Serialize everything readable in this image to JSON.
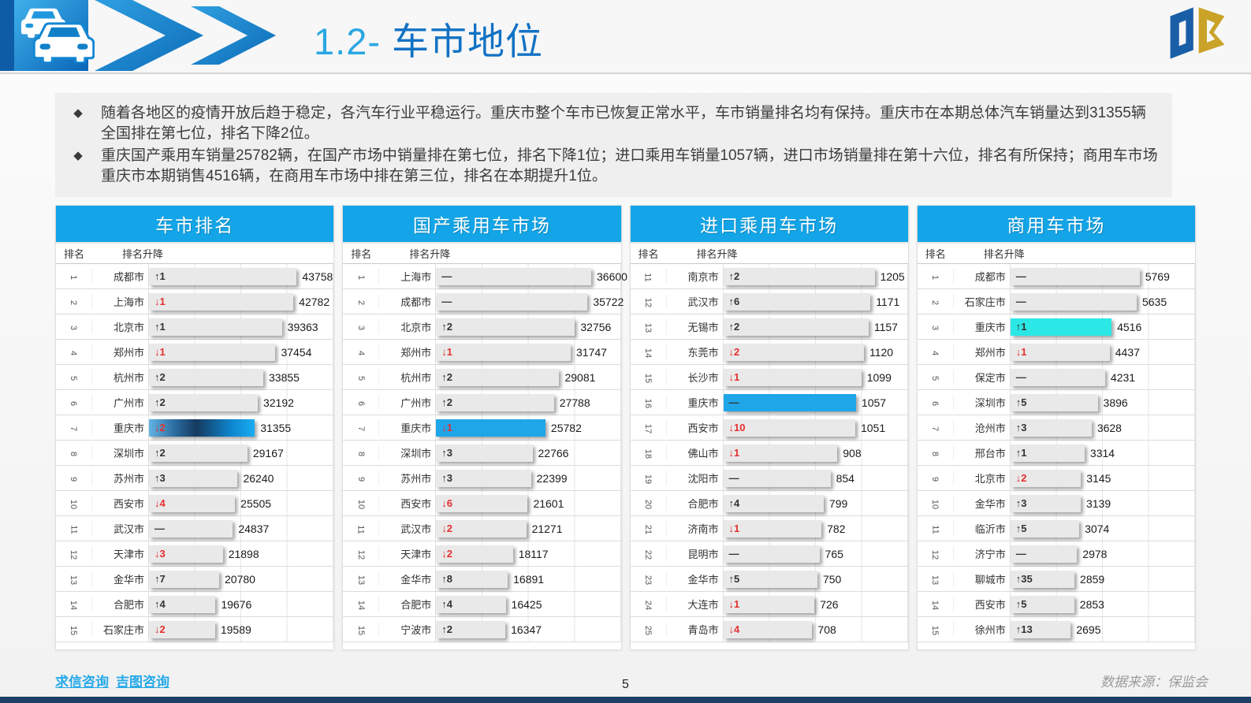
{
  "header": {
    "title_prefix": "1.2-",
    "title_main": " 车市地位"
  },
  "bullets": [
    "随着各地区的疫情开放后趋于稳定，各汽车行业平稳运行。重庆市整个车市已恢复正常水平，车市销量排名均有保持。重庆市在本期总体汽车销量达到31355辆全国排在第七位，排名下降2位。",
    "重庆国产乘用车销量25782辆，在国产市场中销量排在第七位，排名下降1位；进口乘用车销量1057辆，进口市场销量排在第十六位，排名有所保持；商用车市场重庆市本期销售4516辆，在商用车市场中排在第三位，排名在本期提升1位。"
  ],
  "columns": {
    "rank": "排名",
    "change": "排名升降"
  },
  "colors": {
    "table_header_blue": "#13a5e7",
    "highlight_blue": "#1fa6e8",
    "highlight_cyan": "#2be8e6",
    "down_red": "#e52f2f",
    "bar_gray": "#e9e9e9"
  },
  "chart_data": [
    {
      "type": "bar",
      "orientation": "horizontal",
      "title": "车市排名",
      "highlight_style": "gradient",
      "max": 43758,
      "bar_max_fraction": 0.8,
      "rows": [
        {
          "rank": "1",
          "city": "成都市",
          "change": "↑1",
          "dir": "up",
          "value": 43758,
          "highlight": false
        },
        {
          "rank": "2",
          "city": "上海市",
          "change": "↓1",
          "dir": "down",
          "value": 42782,
          "highlight": false
        },
        {
          "rank": "3",
          "city": "北京市",
          "change": "↑1",
          "dir": "up",
          "value": 39363,
          "highlight": false
        },
        {
          "rank": "4",
          "city": "郑州市",
          "change": "↓1",
          "dir": "down",
          "value": 37454,
          "highlight": false
        },
        {
          "rank": "5",
          "city": "杭州市",
          "change": "↑2",
          "dir": "up",
          "value": 33855,
          "highlight": false
        },
        {
          "rank": "6",
          "city": "广州市",
          "change": "↑2",
          "dir": "up",
          "value": 32192,
          "highlight": false
        },
        {
          "rank": "7",
          "city": "重庆市",
          "change": "↓2",
          "dir": "down",
          "value": 31355,
          "highlight": true
        },
        {
          "rank": "8",
          "city": "深圳市",
          "change": "↑2",
          "dir": "up",
          "value": 29167,
          "highlight": false
        },
        {
          "rank": "9",
          "city": "苏州市",
          "change": "↑3",
          "dir": "up",
          "value": 26240,
          "highlight": false
        },
        {
          "rank": "10",
          "city": "西安市",
          "change": "↓4",
          "dir": "down",
          "value": 25505,
          "highlight": false
        },
        {
          "rank": "11",
          "city": "武汉市",
          "change": "—",
          "dir": "flat",
          "value": 24837,
          "highlight": false
        },
        {
          "rank": "12",
          "city": "天津市",
          "change": "↓3",
          "dir": "down",
          "value": 21898,
          "highlight": false
        },
        {
          "rank": "13",
          "city": "金华市",
          "change": "↑7",
          "dir": "up",
          "value": 20780,
          "highlight": false
        },
        {
          "rank": "14",
          "city": "合肥市",
          "change": "↑4",
          "dir": "up",
          "value": 19676,
          "highlight": false
        },
        {
          "rank": "15",
          "city": "石家庄市",
          "change": "↓2",
          "dir": "down",
          "value": 19589,
          "highlight": false
        }
      ]
    },
    {
      "type": "bar",
      "orientation": "horizontal",
      "title": "国产乘用车市场",
      "highlight_style": "solid-blue",
      "max": 36600,
      "bar_max_fraction": 0.84,
      "rows": [
        {
          "rank": "1",
          "city": "上海市",
          "change": "—",
          "dir": "flat",
          "value": 36600,
          "highlight": false
        },
        {
          "rank": "2",
          "city": "成都市",
          "change": "—",
          "dir": "flat",
          "value": 35722,
          "highlight": false
        },
        {
          "rank": "3",
          "city": "北京市",
          "change": "↑2",
          "dir": "up",
          "value": 32756,
          "highlight": false
        },
        {
          "rank": "4",
          "city": "郑州市",
          "change": "↓1",
          "dir": "down",
          "value": 31747,
          "highlight": false
        },
        {
          "rank": "5",
          "city": "杭州市",
          "change": "↑2",
          "dir": "up",
          "value": 29081,
          "highlight": false
        },
        {
          "rank": "6",
          "city": "广州市",
          "change": "↑2",
          "dir": "up",
          "value": 27788,
          "highlight": false
        },
        {
          "rank": "7",
          "city": "重庆市",
          "change": "↓1",
          "dir": "down",
          "value": 25782,
          "highlight": true
        },
        {
          "rank": "8",
          "city": "深圳市",
          "change": "↑3",
          "dir": "up",
          "value": 22766,
          "highlight": false
        },
        {
          "rank": "9",
          "city": "苏州市",
          "change": "↑3",
          "dir": "up",
          "value": 22399,
          "highlight": false
        },
        {
          "rank": "10",
          "city": "西安市",
          "change": "↓6",
          "dir": "down",
          "value": 21601,
          "highlight": false
        },
        {
          "rank": "11",
          "city": "武汉市",
          "change": "↓2",
          "dir": "down",
          "value": 21271,
          "highlight": false
        },
        {
          "rank": "12",
          "city": "天津市",
          "change": "↓2",
          "dir": "down",
          "value": 18117,
          "highlight": false
        },
        {
          "rank": "13",
          "city": "金华市",
          "change": "↑8",
          "dir": "up",
          "value": 16891,
          "highlight": false
        },
        {
          "rank": "14",
          "city": "合肥市",
          "change": "↑4",
          "dir": "up",
          "value": 16425,
          "highlight": false
        },
        {
          "rank": "15",
          "city": "宁波市",
          "change": "↑2",
          "dir": "up",
          "value": 16347,
          "highlight": false
        }
      ]
    },
    {
      "type": "bar",
      "orientation": "horizontal",
      "title": "进口乘用车市场",
      "highlight_style": "solid-blue",
      "max": 1205,
      "bar_max_fraction": 0.82,
      "rows": [
        {
          "rank": "11",
          "city": "南京市",
          "change": "↑2",
          "dir": "up",
          "value": 1205,
          "highlight": false
        },
        {
          "rank": "12",
          "city": "武汉市",
          "change": "↑6",
          "dir": "up",
          "value": 1171,
          "highlight": false
        },
        {
          "rank": "13",
          "city": "无锡市",
          "change": "↑2",
          "dir": "up",
          "value": 1157,
          "highlight": false
        },
        {
          "rank": "14",
          "city": "东莞市",
          "change": "↓2",
          "dir": "down",
          "value": 1120,
          "highlight": false
        },
        {
          "rank": "15",
          "city": "长沙市",
          "change": "↓1",
          "dir": "down",
          "value": 1099,
          "highlight": false
        },
        {
          "rank": "16",
          "city": "重庆市",
          "change": "—",
          "dir": "flat",
          "value": 1057,
          "highlight": true
        },
        {
          "rank": "17",
          "city": "西安市",
          "change": "↓10",
          "dir": "down",
          "value": 1051,
          "highlight": false
        },
        {
          "rank": "18",
          "city": "佛山市",
          "change": "↓1",
          "dir": "down",
          "value": 908,
          "highlight": false
        },
        {
          "rank": "19",
          "city": "沈阳市",
          "change": "—",
          "dir": "flat",
          "value": 854,
          "highlight": false
        },
        {
          "rank": "20",
          "city": "合肥市",
          "change": "↑4",
          "dir": "up",
          "value": 799,
          "highlight": false
        },
        {
          "rank": "21",
          "city": "济南市",
          "change": "↓1",
          "dir": "down",
          "value": 782,
          "highlight": false
        },
        {
          "rank": "22",
          "city": "昆明市",
          "change": "—",
          "dir": "flat",
          "value": 765,
          "highlight": false
        },
        {
          "rank": "23",
          "city": "金华市",
          "change": "↑5",
          "dir": "up",
          "value": 750,
          "highlight": false
        },
        {
          "rank": "24",
          "city": "大连市",
          "change": "↓1",
          "dir": "down",
          "value": 726,
          "highlight": false
        },
        {
          "rank": "25",
          "city": "青岛市",
          "change": "↓4",
          "dir": "down",
          "value": 708,
          "highlight": false
        }
      ]
    },
    {
      "type": "bar",
      "orientation": "horizontal",
      "title": "商用车市场",
      "highlight_style": "cyan",
      "max": 5769,
      "bar_max_fraction": 0.7,
      "rows": [
        {
          "rank": "1",
          "city": "成都市",
          "change": "—",
          "dir": "flat",
          "value": 5769,
          "highlight": false
        },
        {
          "rank": "2",
          "city": "石家庄市",
          "change": "—",
          "dir": "flat",
          "value": 5635,
          "highlight": false
        },
        {
          "rank": "3",
          "city": "重庆市",
          "change": "↑1",
          "dir": "up",
          "value": 4516,
          "highlight": true
        },
        {
          "rank": "4",
          "city": "郑州市",
          "change": "↓1",
          "dir": "down",
          "value": 4437,
          "highlight": false
        },
        {
          "rank": "5",
          "city": "保定市",
          "change": "—",
          "dir": "flat",
          "value": 4231,
          "highlight": false
        },
        {
          "rank": "6",
          "city": "深圳市",
          "change": "↑5",
          "dir": "up",
          "value": 3896,
          "highlight": false
        },
        {
          "rank": "7",
          "city": "沧州市",
          "change": "↑3",
          "dir": "up",
          "value": 3628,
          "highlight": false
        },
        {
          "rank": "8",
          "city": "邢台市",
          "change": "↑1",
          "dir": "up",
          "value": 3314,
          "highlight": false
        },
        {
          "rank": "9",
          "city": "北京市",
          "change": "↓2",
          "dir": "down",
          "value": 3145,
          "highlight": false
        },
        {
          "rank": "10",
          "city": "金华市",
          "change": "↑3",
          "dir": "up",
          "value": 3139,
          "highlight": false
        },
        {
          "rank": "11",
          "city": "临沂市",
          "change": "↑5",
          "dir": "up",
          "value": 3074,
          "highlight": false
        },
        {
          "rank": "12",
          "city": "济宁市",
          "change": "—",
          "dir": "flat",
          "value": 2978,
          "highlight": false
        },
        {
          "rank": "13",
          "city": "聊城市",
          "change": "↑35",
          "dir": "up",
          "value": 2859,
          "highlight": false
        },
        {
          "rank": "14",
          "city": "西安市",
          "change": "↑5",
          "dir": "up",
          "value": 2853,
          "highlight": false
        },
        {
          "rank": "15",
          "city": "徐州市",
          "change": "↑13",
          "dir": "up",
          "value": 2695,
          "highlight": false
        }
      ]
    }
  ],
  "footer": {
    "links": [
      "求信咨询",
      "吉图咨询"
    ],
    "page": "5",
    "source": "数据来源：保监会"
  }
}
